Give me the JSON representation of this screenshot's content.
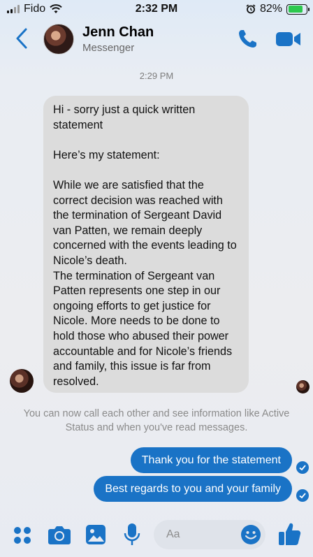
{
  "status": {
    "carrier": "Fido",
    "time": "2:32 PM",
    "battery": "82%",
    "battery_level": 0.82
  },
  "header": {
    "name": "Jenn Chan",
    "subtitle": "Messenger"
  },
  "conversation": {
    "timestamp": "2:29 PM",
    "incoming_message": "Hi - sorry just a quick written statement\n\nHere’s my statement:\n\nWhile we are satisfied that the correct decision was reached with the termination of Sergeant David van Patten, we remain deeply concerned with the events leading to Nicole’s death.\nThe termination of Sergeant van Patten represents one step in our ongoing efforts to get justice for Nicole. More needs to be done to hold those who abused their power accountable and for Nicole’s friends and family, this issue is far from resolved.",
    "info_text": "You can now call each other and see information like Active Status and when you've read messages.",
    "outgoing": [
      "Thank you for the statement",
      "Best regards to you and your family"
    ]
  },
  "composer": {
    "placeholder": "Aa"
  },
  "colors": {
    "accent": "#1a73c6",
    "incoming_bubble": "#dcdcdc",
    "battery_green": "#2cc84d"
  }
}
